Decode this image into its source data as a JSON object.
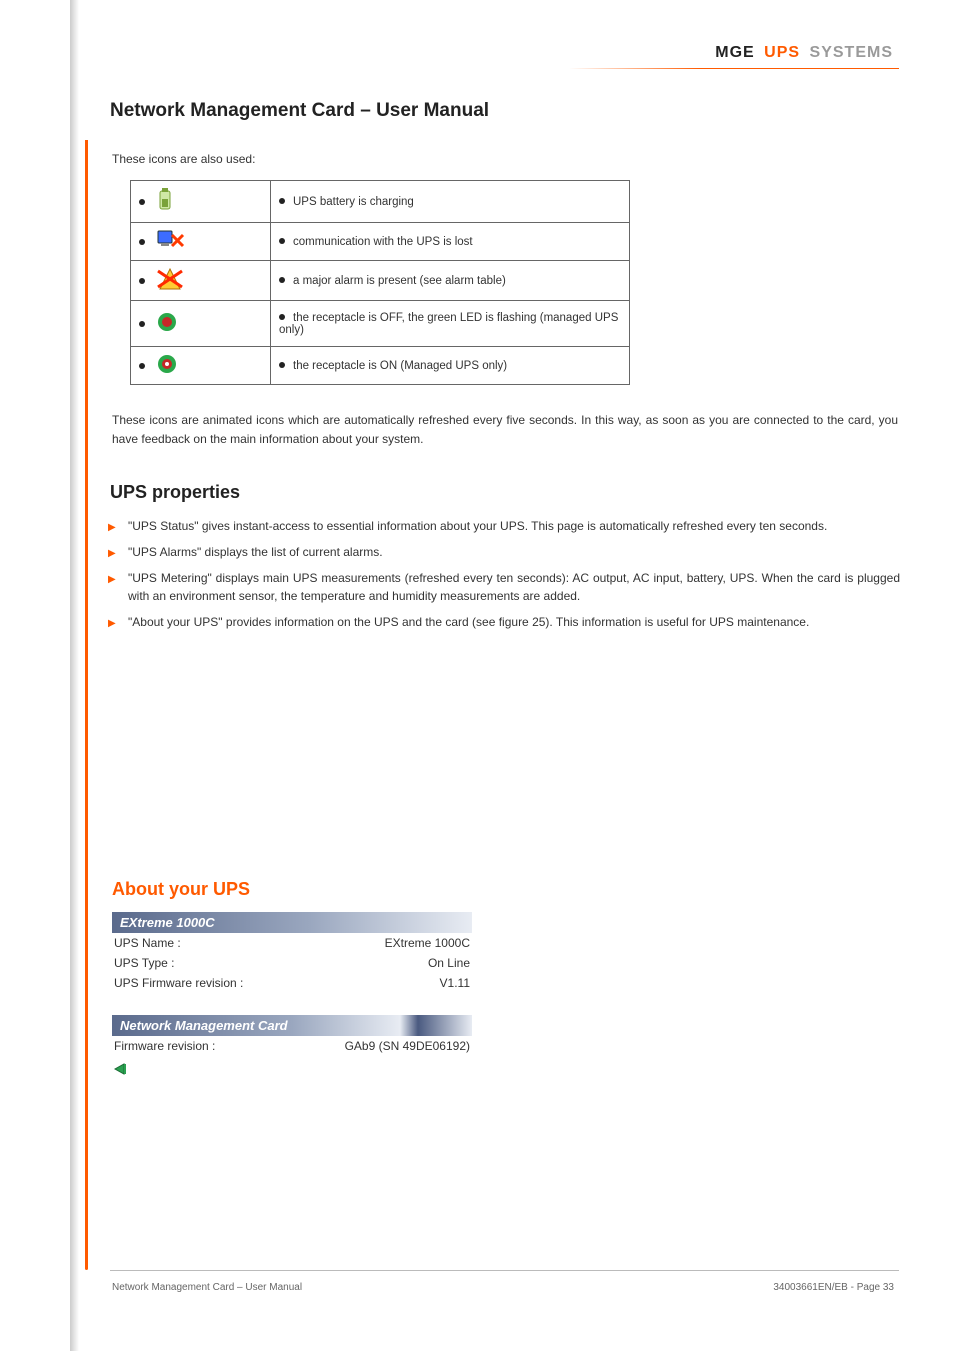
{
  "brand": {
    "mge": "MGE",
    "ups": "UPS",
    "systems": "SYSTEMS"
  },
  "page_title": "Network Management Card – User Manual",
  "icons_intro": "These icons are also used:",
  "icon_rows": [
    {
      "desc": "UPS battery is charging"
    },
    {
      "desc": "communication with the UPS is lost"
    },
    {
      "desc": "a major alarm is present (see alarm table)"
    },
    {
      "desc": "the receptacle is OFF, the green LED is flashing (managed UPS only)"
    },
    {
      "desc": "the receptacle is ON (Managed UPS only)"
    }
  ],
  "animated_para": "These icons are animated icons which are automatically refreshed every five seconds. In this way, as soon as you are connected to the card, you have feedback on the main information about your system.",
  "sec_ups_props": "UPS properties",
  "ups_props_items": [
    "\"UPS Status\" gives instant-access to essential information about your UPS. This page is automatically refreshed every ten seconds.",
    "\"UPS Alarms\" displays the list of current alarms.",
    "\"UPS Metering\" displays main UPS measurements (refreshed every ten seconds): AC output, AC input, battery, UPS. When the card is plugged with an environment sensor, the temperature and humidity measurements are added.",
    "\"About your UPS\" provides information on the UPS and the card (see figure 25). This information is useful for UPS maintenance."
  ],
  "about_ups_heading": "About your UPS",
  "panel1_title": "EXtreme 1000C",
  "panel1_rows": [
    {
      "k": "UPS Name :",
      "v": "EXtreme 1000C"
    },
    {
      "k": "UPS Type :",
      "v": "On Line"
    },
    {
      "k": "UPS Firmware revision :",
      "v": "V1.11"
    }
  ],
  "panel2_title": "Network Management Card",
  "panel2_rows": [
    {
      "k": "Firmware revision :",
      "v": "GAb9 (SN 49DE06192)"
    }
  ],
  "footer_left": "Network Management Card – User Manual",
  "footer_right": "34003661EN/EB - Page 33"
}
